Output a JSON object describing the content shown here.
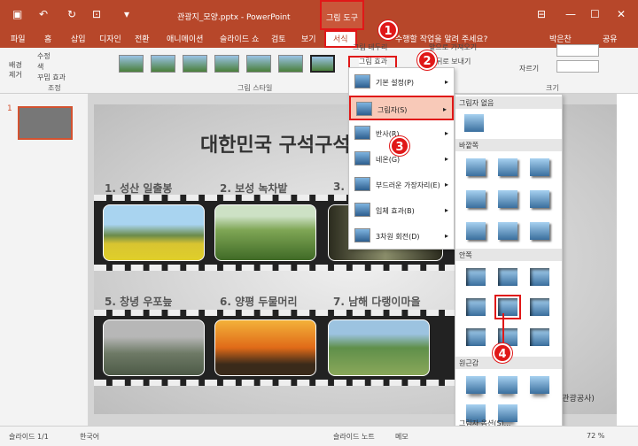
{
  "titlebar": {
    "doc_title": "관광지_모양.pptx - PowerPoint",
    "context_tab": "그림 도구",
    "user": "박은찬",
    "share": "공유",
    "tell_me": "수행할 작업을 알려 주세요?"
  },
  "tabs": [
    "파일",
    "홈",
    "삽입",
    "디자인",
    "전환",
    "애니메이션",
    "슬라이드 쇼",
    "검토",
    "보기",
    "서식"
  ],
  "ribbon": {
    "bg_remove": "배경\n제거",
    "fix": "수정",
    "color": "색",
    "art": "꾸밈 효과",
    "adjust_group": "조정",
    "styles_group": "그림 스타일",
    "border": "그림 테두리",
    "effects": "그림 효과",
    "bring_forward": "앞으로 가져오기",
    "send_backward": "뒤로 보내기",
    "crop": "자르기",
    "size_group": "크기"
  },
  "slide_panel": {
    "number": "1"
  },
  "slide": {
    "title": "대한민국 구석구석",
    "captions": [
      "1. 성산 일출봉",
      "2. 보성 녹차밭",
      "3.",
      "5. 창녕 우포늪",
      "6. 양평 두물머리",
      "7. 남해 다랭이마을"
    ],
    "footer": "국관광공사)"
  },
  "menu1": [
    {
      "label": "기본 설정(P)"
    },
    {
      "label": "그림자(S)"
    },
    {
      "label": "반사(R)"
    },
    {
      "label": "네온(G)"
    },
    {
      "label": "부드러운 가장자리(E)"
    },
    {
      "label": "입체 효과(B)"
    },
    {
      "label": "3차원 회전(D)"
    }
  ],
  "menu2": {
    "none": "그림자 없음",
    "outer": "바깥쪽",
    "inner": "안쪽",
    "perspective": "원근감",
    "options": "그림자 옵션(S)..."
  },
  "badges": [
    "1",
    "2",
    "3",
    "4"
  ],
  "status": {
    "slide": "슬라이드 1/1",
    "lang": "한국어",
    "notes": "슬라이드 노트",
    "comments": "메모",
    "zoom": "72 %"
  },
  "colors": {
    "accent": "#b7472a",
    "highlight": "#e01818",
    "menu_hover": "#f8c9b8"
  }
}
